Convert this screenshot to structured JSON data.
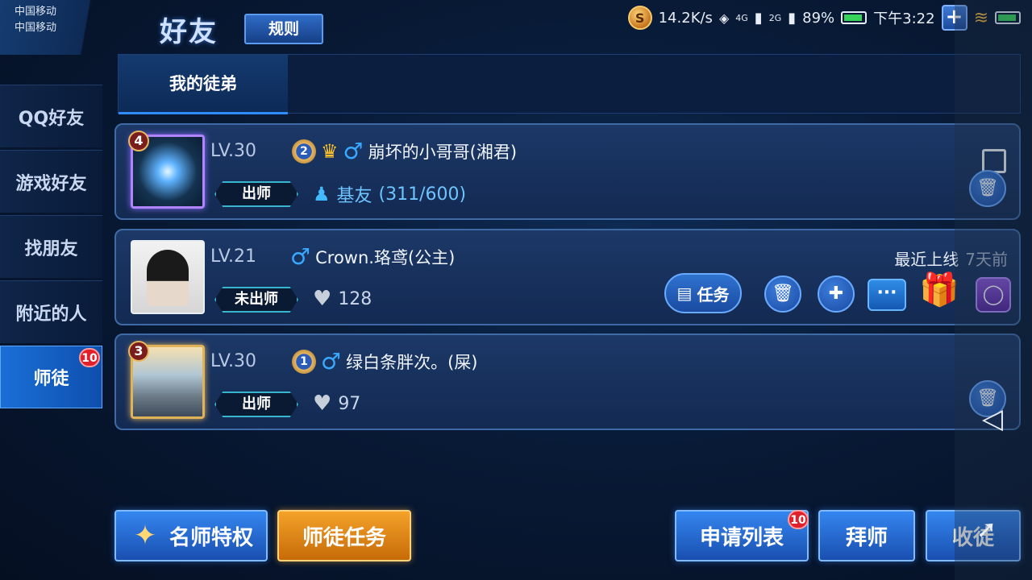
{
  "status_bar": {
    "carrier_1": "中国移动",
    "carrier_2": "中国移动",
    "speed": "14.2K/s",
    "signal_1": "4G",
    "signal_2": "2G",
    "battery": "89%",
    "time": "下午3:22"
  },
  "header": {
    "title": "好友",
    "rules_label": "规则"
  },
  "sidebar": {
    "items": [
      {
        "label": "QQ好友"
      },
      {
        "label": "游戏好友"
      },
      {
        "label": "找朋友"
      },
      {
        "label": "附近的人"
      },
      {
        "label": "师徒",
        "badge": "10",
        "active": true
      }
    ]
  },
  "tabs": {
    "active": "我的徒弟"
  },
  "apprentices": [
    {
      "rank": "4",
      "level": "LV.30",
      "medal": "2",
      "name": "崩坏的小哥哥(湘君)",
      "status": "出师",
      "relation_label": "基友",
      "relation_count": "(311/600)"
    },
    {
      "level": "LV.21",
      "name": "Crown.珞鸢(公主)",
      "status": "未出师",
      "intimacy": "128",
      "last_online_label": "最近上线",
      "last_online_value": "7天前",
      "task_label": "任务"
    },
    {
      "rank": "3",
      "level": "LV.30",
      "medal": "1",
      "name": "绿白条胖次。(屎)",
      "status": "出师",
      "intimacy": "97"
    }
  ],
  "bottom": {
    "master_privilege": "名师特权",
    "mentor_tasks": "师徒任务",
    "apply_list": "申请列表",
    "apply_badge": "10",
    "become_apprentice": "拜师",
    "take_apprentice": "收徒"
  },
  "colors": {
    "accent_blue": "#2f8cff",
    "gold": "#f4a22a",
    "badge_red": "#e0202a"
  }
}
